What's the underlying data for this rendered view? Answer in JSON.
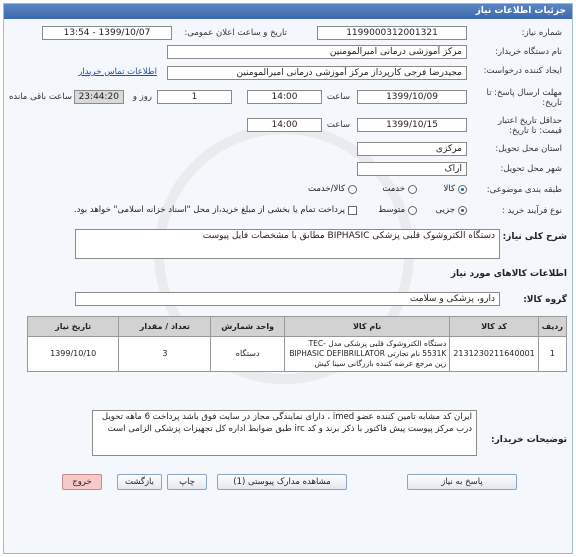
{
  "header": {
    "title": "جزئیات اطلاعات نیاز"
  },
  "form": {
    "need_number_label": "شماره نیاز:",
    "need_number": "1199000312001321",
    "announce_label": "تاریخ و ساعت اعلان عمومی:",
    "announce_value": "1399/10/07 - 13:54",
    "buyer_org_label": "نام دستگاه خریدار:",
    "buyer_org": "مرکز آموزشی درمانی امیرالمومنین",
    "creator_label": "ایجاد کننده درخواست:",
    "creator": "مجیدرضا فرجی کارپرداز مرکز آموزشی درمانی امیرالمومنین",
    "contact_link": "اطلاعات تماس خریدار",
    "reply_deadline_label": "مهلت ارسال پاسخ: تا تاریخ:",
    "reply_date": "1399/10/09",
    "time_label": "ساعت",
    "reply_time": "14:00",
    "days_value": "1",
    "days_label": "روز و",
    "remaining_time": "23:44:20",
    "remaining_label": "ساعت باقی مانده",
    "price_deadline_label": "حداقل تاریخ اعتبار قیمت: تا تاریخ:",
    "price_date": "1399/10/15",
    "price_time": "14:00",
    "province_label": "استان محل تحویل:",
    "province": "مرکزی",
    "city_label": "شهر محل تحویل:",
    "city": "اراک",
    "category_label": "طبقه بندی موضوعی:",
    "category_options": [
      "کالا",
      "خدمت",
      "کالا/خدمت"
    ],
    "process_label": "نوع فرآیند خرید :",
    "process_options": [
      "جزیی",
      "متوسط"
    ],
    "payment_note": "پرداخت تمام یا بخشی از مبلغ خرید،از محل \"اسناد خزانه اسلامی\" خواهد بود."
  },
  "summary": {
    "label": "شرح کلی نیاز:",
    "text": "دستگاه الکتروشوک قلبی پزشکی  BIPHASIC مطابق با مشخصات فایل پیوست"
  },
  "goods": {
    "section_title": "اطلاعات کالاهای مورد نیاز",
    "group_label": "گروه کالا:",
    "group_value": "دارو، پزشکی و سلامت",
    "columns": [
      "ردیف",
      "کد کالا",
      "نام کالا",
      "واحد شمارش",
      "تعداد / مقدار",
      "تاریخ نیاز"
    ],
    "rows": [
      {
        "idx": "1",
        "code": "2131230211640001",
        "name": "دستگاه الکتروشوک قلبی پزشکی مدل TEC-5531K نام تجارتی BIPHASIC DEFIBRILLATOR زین مرجع عرضه کننده بازرگانی سینا کیش",
        "unit": "دستگاه",
        "qty": "3",
        "date": "1399/10/10"
      }
    ]
  },
  "buyer_notes": {
    "label": "توضیحات خریدار:",
    "text": "ایران کد مشابه تامین کننده عضو imed ، دارای نمایندگی مجاز در سایت فوق باشد  پرداخت 6 ماهه تحویل درب مرکز پیوست پیش فاکتور با ذکر برند و کد irc  طبق ضوابط اداره کل تجهیزات پزشکی الزامی است"
  },
  "buttons": {
    "reply": "پاسخ به نیاز",
    "docs": "مشاهده مدارک پیوستی (1)",
    "print": "چاپ",
    "back": "بازگشت",
    "exit": "خروج"
  }
}
